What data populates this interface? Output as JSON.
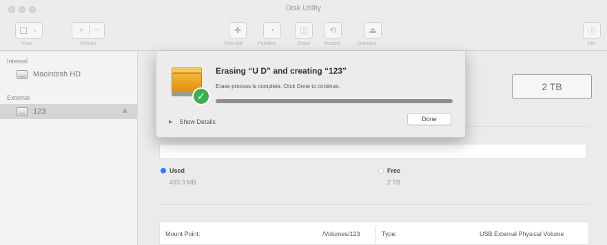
{
  "window": {
    "title": "Disk Utility"
  },
  "toolbar": {
    "view_label": "View",
    "volume_label": "Volume",
    "first_aid_label": "First Aid",
    "partition_label": "Partition",
    "erase_label": "Erase",
    "restore_label": "Restore",
    "unmount_label": "Unmount",
    "info_label": "Info"
  },
  "sidebar": {
    "internal_header": "Internal",
    "external_header": "External",
    "items": [
      {
        "label": "Macintosh HD",
        "section": "internal"
      },
      {
        "label": "123",
        "section": "external",
        "selected": true,
        "eject": "≜"
      }
    ]
  },
  "main": {
    "capacity": "2 TB",
    "used_label": "Used",
    "used_value": "493.3 MB",
    "used_color": "#2e7cf6",
    "free_label": "Free",
    "free_value": "2 TB",
    "free_color": "#ffffff",
    "table": {
      "mount_point_label": "Mount Point:",
      "mount_point_value": "/Volumes/123",
      "type_label": "Type:",
      "type_value": "USB External Physical Volume"
    }
  },
  "sheet": {
    "title": "Erasing “U D” and creating “123”",
    "message": "Erase process is complete. Click Done to continue.",
    "progress_percent": 100,
    "show_details_label": "Show Details",
    "done_label": "Done",
    "success_color": "#3ab04e"
  }
}
